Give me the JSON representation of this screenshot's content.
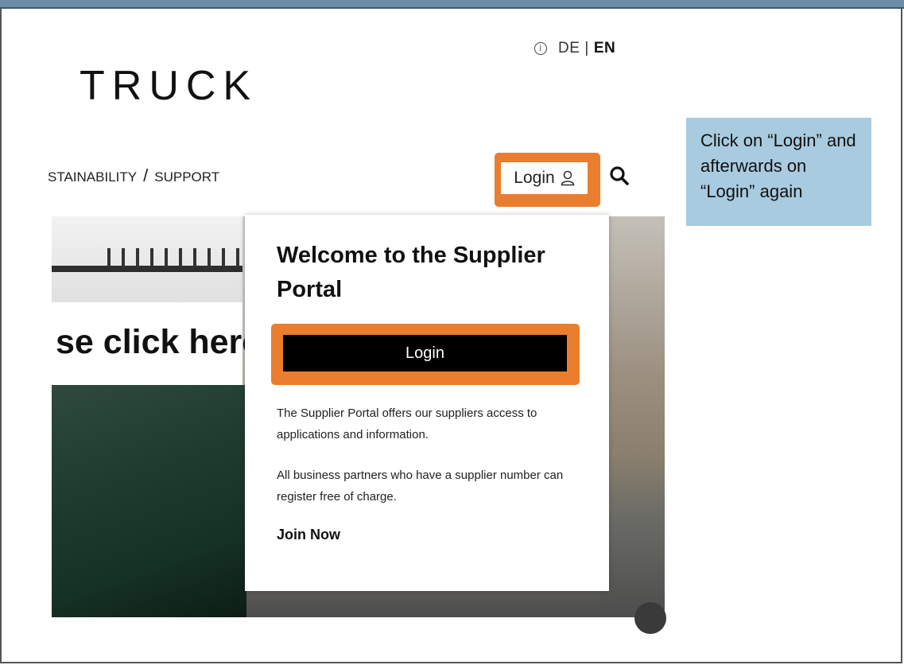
{
  "header": {
    "lang_de": "DE",
    "lang_sep": "|",
    "lang_en": "EN",
    "info_icon_glyph": "i",
    "logo": "TRUCK"
  },
  "nav": {
    "items_text": "STAINABILITY",
    "separator": "/",
    "support": "SUPPORT"
  },
  "header_login": {
    "label": "Login",
    "icon": "user-icon"
  },
  "search": {
    "icon": "search-icon"
  },
  "hero": {
    "text": "se click here"
  },
  "panel": {
    "title": "Welcome to the Supplier Portal",
    "login_button": "Login",
    "paragraph1": "The Supplier Portal offers our suppliers access to applications and information.",
    "paragraph2": "All business partners who have a supplier number can register free of charge.",
    "join_link": "Join Now"
  },
  "tooltip": {
    "text": "Click on “Login” and afterwards on “Login” again"
  },
  "colors": {
    "highlight": "#ea7d2e",
    "tooltip_bg": "#a9cbe0",
    "button_bg": "#000000"
  }
}
